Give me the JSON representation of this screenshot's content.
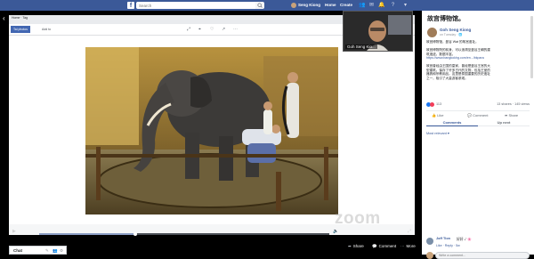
{
  "topbar": {
    "logo": "f",
    "search_placeholder": "Search",
    "user_name": "Seng Kiong",
    "home": "Home",
    "create": "Create",
    "icons": [
      "friends-icon",
      "messenger-icon",
      "notifications-icon",
      "help-icon",
      "menu-icon"
    ]
  },
  "viewer": {
    "tab_active": "Tai photos",
    "tab_other": "Add to",
    "crumb": "Home · Tag",
    "tools": [
      "zoom-in-icon",
      "tag-icon",
      "like-icon",
      "share-icon",
      "options-icon"
    ],
    "progress": 0.33,
    "zoom_watermark": "zoom",
    "actions": {
      "share": "Share",
      "comment": "Comment",
      "more": "More"
    }
  },
  "video": {
    "name": "Goh Seng Kio..."
  },
  "chat": {
    "label": "Chat"
  },
  "panel": {
    "title": "故宫博物馆。",
    "author": "Goh Seng Kiong",
    "meta": "on Tuesday · 🌐",
    "body_lines": [
      "故宫博物馆，曼谷 Wat 的故宫遗址。",
      "",
      "故宫博物院的前身，可以追溯至曼谷王朝的建",
      "筑遗迹。数据丰富。",
      "https://www.bangkokhg.com/en.../bkpara",
      "",
      "故宫曾经由王国的皇家，曾经是曼谷王宫的大",
      "型建筑。保存了许多古代的文物，包括王室的",
      "器具和宗教用品。这里是泰国重要的历史遗址",
      "之一，吸引了大量游客参观。"
    ],
    "reactions_count": "113",
    "shares": "13 shares · 145 views",
    "like": "Like",
    "comment": "Comment",
    "share": "Share",
    "tab_comments": "Comments",
    "tab_upnext": "Up next",
    "sort": "Most relevant",
    "comment_name": "Joff Tion",
    "comment_text": "好好 ✓ 🌸",
    "comment_actions": "Like · Reply · 5w",
    "comment_placeholder": "Write a comment..."
  }
}
